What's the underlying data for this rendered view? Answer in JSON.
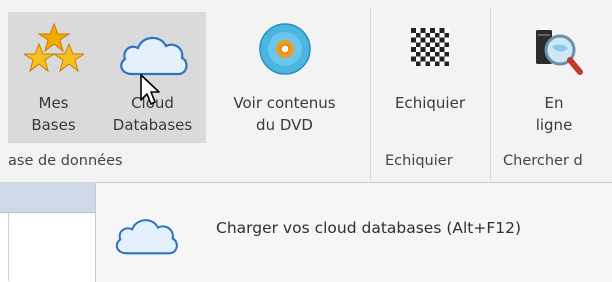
{
  "ribbon": {
    "buttons": [
      {
        "line1": "Mes",
        "line2": "Bases",
        "icon": "stars-icon"
      },
      {
        "line1": "Cloud",
        "line2": "Databases",
        "icon": "cloud-icon"
      },
      {
        "line1": "Voir contenus",
        "line2": "du DVD",
        "icon": "dvd-icon"
      },
      {
        "line1": "Echiquier",
        "line2": "",
        "icon": "chessboard-icon"
      },
      {
        "line1": "En",
        "line2": "ligne",
        "icon": "search-online-icon"
      }
    ],
    "groups": [
      "ase de données",
      "Echiquier",
      "Chercher d"
    ]
  },
  "dropdown": {
    "item_label": "Charger vos cloud databases (Alt+F12)",
    "icon": "cloud-icon"
  },
  "colors": {
    "ribbon_bg": "#f3f3f3",
    "hover_bg": "#dadada",
    "cloud_fill": "#e4f0fb",
    "cloud_stroke": "#2f73c0",
    "star": "#f2a900",
    "dvd": "#4cb6e3"
  }
}
